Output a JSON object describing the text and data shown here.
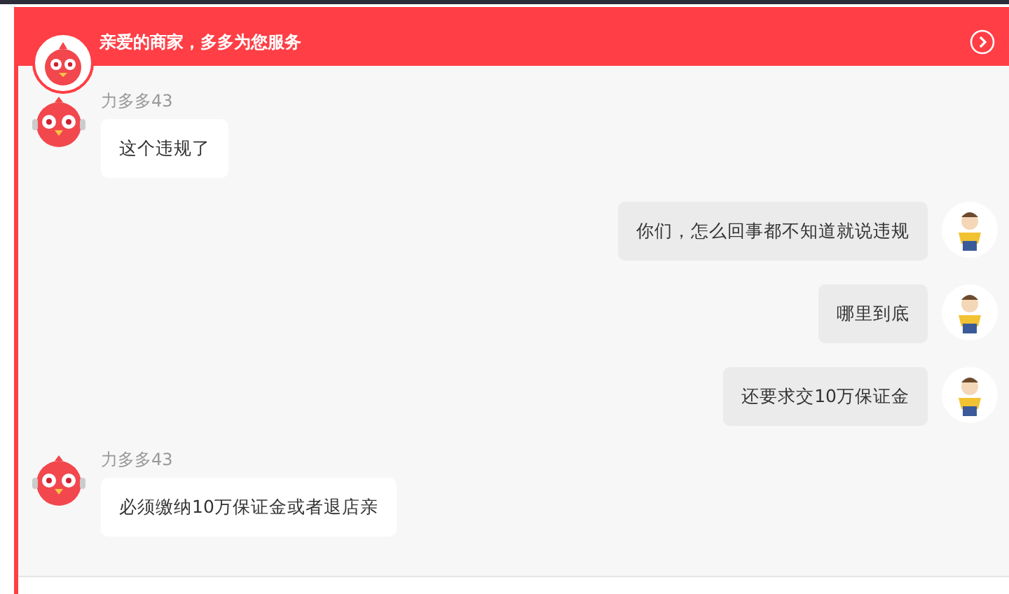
{
  "header": {
    "title": "亲爱的商家，多多为您服务"
  },
  "messages": [
    {
      "kind": "incoming",
      "sender": "力多多43",
      "text": "这个违规了"
    },
    {
      "kind": "outgoing",
      "text": "你们，怎么回事都不知道就说违规"
    },
    {
      "kind": "outgoing",
      "text": "哪里到底"
    },
    {
      "kind": "outgoing",
      "text": "还要求交10万保证金"
    },
    {
      "kind": "incoming",
      "sender": "力多多43",
      "text": "必须缴纳10万保证金或者退店亲"
    }
  ]
}
